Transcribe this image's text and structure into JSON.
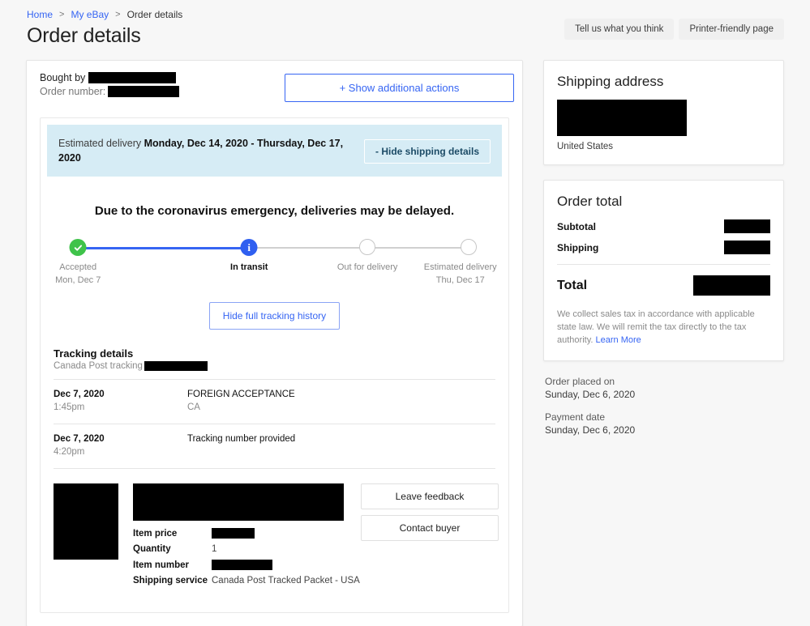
{
  "breadcrumb": {
    "home": "Home",
    "my_ebay": "My eBay",
    "current": "Order details",
    "separator": ">"
  },
  "page_title": "Order details",
  "top_actions": {
    "feedback": "Tell us what you think",
    "printer": "Printer-friendly page"
  },
  "order_header": {
    "bought_by_label": "Bought by",
    "order_number_label": "Order number:",
    "show_additional_actions": "+ Show additional actions"
  },
  "shipping": {
    "estimated_label": "Estimated delivery",
    "estimated_value": "Monday, Dec 14, 2020 - Thursday, Dec 17, 2020",
    "hide_shipping_details": "- Hide shipping details",
    "coronavirus_notice": "Due to the coronavirus emergency, deliveries may be delayed.",
    "hide_full_tracking_history": "Hide full tracking history"
  },
  "stepper": {
    "steps": [
      {
        "label": "Accepted",
        "sub": "Mon, Dec 7",
        "state": "done",
        "icon": "check-circle-icon"
      },
      {
        "label": "In transit",
        "sub": "",
        "state": "current",
        "icon": "info-circle-icon"
      },
      {
        "label": "Out for delivery",
        "sub": "",
        "state": "pending",
        "icon": "empty-circle-icon"
      },
      {
        "label": "Estimated delivery",
        "sub": "Thu, Dec 17",
        "state": "pending",
        "icon": "empty-circle-icon"
      }
    ],
    "colors": {
      "done": "#3fc34a",
      "current": "#2f5ff0",
      "pending": "#c7c7c7",
      "track_done": "#3665f3"
    }
  },
  "tracking": {
    "title": "Tracking details",
    "carrier_label": "Canada Post tracking",
    "events": [
      {
        "date": "Dec 7, 2020",
        "time": "1:45pm",
        "event": "FOREIGN ACCEPTANCE",
        "location": "CA"
      },
      {
        "date": "Dec 7, 2020",
        "time": "4:20pm",
        "event": "Tracking number provided",
        "location": ""
      }
    ]
  },
  "item": {
    "rows": [
      {
        "key": "Item price",
        "value": "",
        "redacted": true
      },
      {
        "key": "Quantity",
        "value": "1",
        "redacted": false
      },
      {
        "key": "Item number",
        "value": "",
        "redacted": true
      },
      {
        "key": "Shipping service",
        "value": "Canada Post Tracked Packet - USA",
        "redacted": false
      }
    ],
    "buttons": [
      {
        "label": "Leave feedback"
      },
      {
        "label": "Contact buyer"
      }
    ]
  },
  "shipping_address": {
    "title": "Shipping address",
    "country": "United States"
  },
  "order_total": {
    "title": "Order total",
    "subtotal_label": "Subtotal",
    "shipping_label": "Shipping",
    "total_label": "Total",
    "tax_note": "We collect sales tax in accordance with applicable state law. We will remit the tax directly to the tax authority.",
    "learn_more": "Learn More"
  },
  "order_meta": {
    "placed_label": "Order placed on",
    "placed_value": "Sunday, Dec 6, 2020",
    "payment_label": "Payment date",
    "payment_value": "Sunday, Dec 6, 2020"
  },
  "theme": {
    "link": "#3665f3",
    "banner_bg": "#d6ecf5",
    "page_bg": "#f7f7f7"
  }
}
